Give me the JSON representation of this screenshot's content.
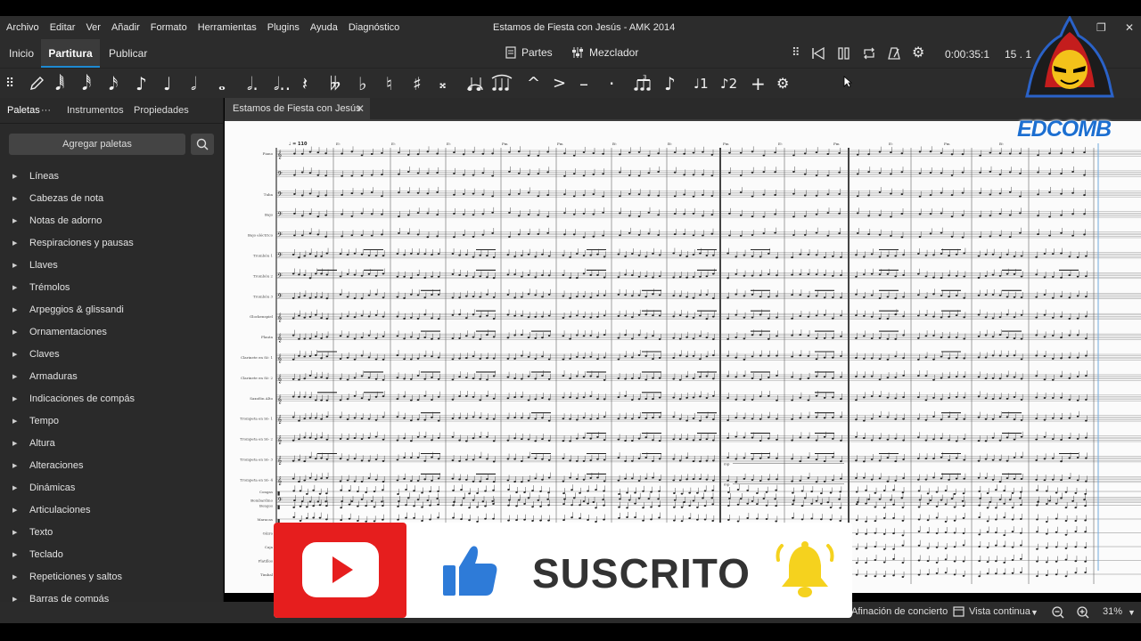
{
  "menu": [
    "Archivo",
    "Editar",
    "Ver",
    "Añadir",
    "Formato",
    "Herramientas",
    "Plugins",
    "Ayuda",
    "Diagnóstico"
  ],
  "window_title": "Estamos de Fiesta con Jesús - AMK 2014",
  "tabs": {
    "home": "Inicio",
    "score": "Partitura",
    "publish": "Publicar"
  },
  "toolbar": {
    "parts": "Partes",
    "mixer": "Mezclador",
    "time": "0:00:35:1",
    "position": "15 . 1"
  },
  "panel_tabs": {
    "palettes": "Paletas",
    "more": "···",
    "instruments": "Instrumentos",
    "properties": "Propiedades"
  },
  "add_palettes": "Agregar paletas",
  "palettes": [
    "Líneas",
    "Cabezas de nota",
    "Notas de adorno",
    "Respiraciones y pausas",
    "Llaves",
    "Trémolos",
    "Arpeggios & glissandi",
    "Ornamentaciones",
    "Claves",
    "Armaduras",
    "Indicaciones de compás",
    "Tempo",
    "Altura",
    "Alteraciones",
    "Dinámicas",
    "Articulaciones",
    "Texto",
    "Teclado",
    "Repeticiones y saltos",
    "Barras de compás"
  ],
  "doc_tab": "Estamos de Fiesta con Jesús ...",
  "score": {
    "tempo_mark": "♩ = 110",
    "instruments": [
      "Piano",
      "",
      "Tuba",
      "Bajo",
      "Bajo eléctrico",
      "Trombón 1",
      "Trombón 2",
      "Trombón 3",
      "Glockenspiel",
      "Flauta",
      "Clarinete en Si♭ 1",
      "Clarinete en Si♭ 2",
      "Saxofón Alto",
      "Trompeta en Si♭ 1",
      "Trompeta en Si♭ 2",
      "Trompeta en Si♭ 3",
      "Trompeta en Si♭ 4",
      "Bombardino",
      "Congas",
      "Bongos",
      "Maracas",
      "Güiro",
      "Caja",
      "Platillos",
      "Timbal"
    ],
    "chords": [
      "E♭",
      "E♭",
      "E♭",
      "Fm",
      "Fm",
      "B♭",
      "B♭",
      "Fm",
      "E♭",
      "Fm",
      "E♭",
      "Fm",
      "B♭"
    ],
    "dynamic": "mp"
  },
  "status": {
    "concert_pitch": "Afinación de concierto",
    "view_mode": "Vista continua",
    "zoom": "31%"
  },
  "overlay": {
    "subscribe_text": "SUSCRITO",
    "logo_text": "EDCOMB"
  },
  "colors": {
    "accent": "#1e8ad2",
    "youtube_red": "#e61e1e",
    "bell_yellow": "#f5d21e",
    "thumb_blue": "#2e7bd8"
  }
}
